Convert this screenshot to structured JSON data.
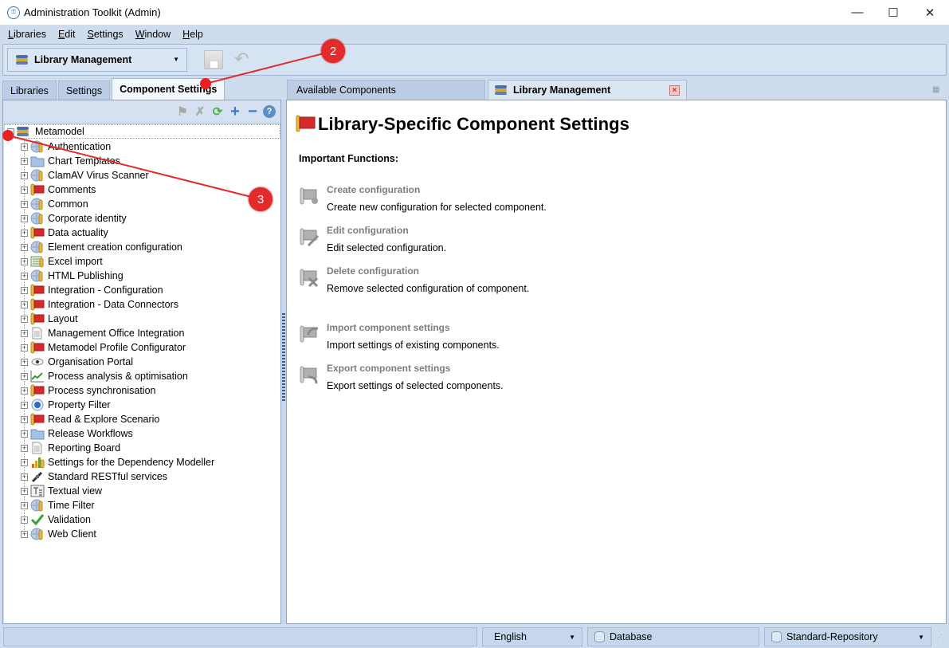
{
  "window": {
    "title": "Administration Toolkit (Admin)",
    "controls": {
      "minimize": "—",
      "maximize": "☐",
      "close": "✕"
    }
  },
  "menu": [
    {
      "label": "Libraries",
      "mnemonic": "L",
      "rest": "ibraries"
    },
    {
      "label": "Edit",
      "mnemonic": "E",
      "rest": "dit"
    },
    {
      "label": "Settings",
      "mnemonic": "S",
      "rest": "ettings"
    },
    {
      "label": "Window",
      "mnemonic": "W",
      "rest": "indow"
    },
    {
      "label": "Help",
      "mnemonic": "H",
      "rest": "elp"
    }
  ],
  "toolbar": {
    "perspective": "Library Management",
    "save_icon": "save-icon",
    "undo_icon": "undo-icon"
  },
  "left_tabs": [
    {
      "label": "Libraries",
      "active": false
    },
    {
      "label": "Settings",
      "active": false
    },
    {
      "label": "Component Settings",
      "active": true
    }
  ],
  "tree_toolbar": [
    "create-configuration-icon",
    "delete-configuration-icon",
    "refresh-icon",
    "expand-all-icon",
    "collapse-all-icon",
    "help-icon"
  ],
  "tree": {
    "root": {
      "label": "Metamodel",
      "icon": "library-icon",
      "expanded": true
    },
    "items": [
      {
        "label": "Authentication",
        "icon": "globe-icon"
      },
      {
        "label": "Chart Templates",
        "icon": "folder-icon"
      },
      {
        "label": "ClamAV Virus Scanner",
        "icon": "globe-icon"
      },
      {
        "label": "Comments",
        "icon": "flag-icon"
      },
      {
        "label": "Common",
        "icon": "globe-icon"
      },
      {
        "label": "Corporate identity",
        "icon": "globe-icon"
      },
      {
        "label": "Data actuality",
        "icon": "flag-icon"
      },
      {
        "label": "Element creation configuration",
        "icon": "globe-icon"
      },
      {
        "label": "Excel import",
        "icon": "excel-icon"
      },
      {
        "label": "HTML Publishing",
        "icon": "globe-icon"
      },
      {
        "label": "Integration - Configuration",
        "icon": "flag-icon"
      },
      {
        "label": "Integration - Data Connectors",
        "icon": "flag-icon"
      },
      {
        "label": "Layout",
        "icon": "flag-icon"
      },
      {
        "label": "Management Office Integration",
        "icon": "document-icon"
      },
      {
        "label": "Metamodel Profile Configurator",
        "icon": "flag-icon"
      },
      {
        "label": "Organisation Portal",
        "icon": "eye-icon"
      },
      {
        "label": "Process analysis & optimisation",
        "icon": "chart-icon"
      },
      {
        "label": "Process synchronisation",
        "icon": "flag-icon"
      },
      {
        "label": "Property Filter",
        "icon": "radio-icon"
      },
      {
        "label": "Read & Explore Scenario",
        "icon": "flag-icon"
      },
      {
        "label": "Release Workflows",
        "icon": "folder-icon"
      },
      {
        "label": "Reporting Board",
        "icon": "document-icon"
      },
      {
        "label": "Settings for the Dependency Modeller",
        "icon": "dependency-icon"
      },
      {
        "label": "Standard RESTful services",
        "icon": "plug-icon"
      },
      {
        "label": "Textual view",
        "icon": "text-icon"
      },
      {
        "label": "Time Filter",
        "icon": "globe-icon"
      },
      {
        "label": "Validation",
        "icon": "check-icon"
      },
      {
        "label": "Web Client",
        "icon": "globe-icon"
      }
    ]
  },
  "right_tabs": [
    {
      "label": "Available Components",
      "active": false
    },
    {
      "label": "Library Management",
      "active": true,
      "closable": true
    }
  ],
  "content": {
    "title": "Library-Specific Component Settings",
    "subtitle": "Important Functions:",
    "functions": [
      {
        "name": "Create configuration",
        "desc": "Create new configuration for selected component.",
        "icon": "create-configuration-icon"
      },
      {
        "name": "Edit configuration",
        "desc": "Edit selected configuration.",
        "icon": "edit-configuration-icon"
      },
      {
        "name": "Delete configuration",
        "desc": "Remove selected configuration of component.",
        "icon": "delete-configuration-icon"
      },
      {
        "name": "Import component settings",
        "desc": "Import settings of existing components.",
        "icon": "import-icon"
      },
      {
        "name": "Export component settings",
        "desc": "Export settings of selected components.",
        "icon": "export-icon"
      }
    ]
  },
  "statusbar": {
    "language": "English",
    "database": "Database",
    "repository": "Standard-Repository"
  },
  "annotations": [
    {
      "number": "2",
      "target": "Component Settings tab"
    },
    {
      "number": "3",
      "target": "Metamodel root node"
    }
  ],
  "colors": {
    "accent": "#cfdcee",
    "annotation": "#e32b2b",
    "flag_red": "#d42a2a"
  }
}
